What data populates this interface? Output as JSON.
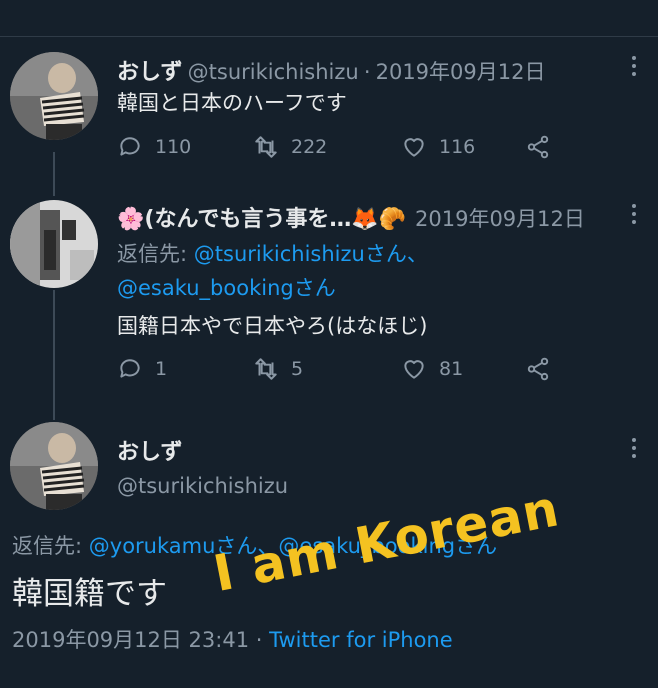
{
  "tweet1": {
    "name": "おしず",
    "handle": "@tsurikichishizu",
    "sep": "·",
    "date": "2019年09月12日",
    "text": "韓国と日本のハーフです",
    "replies": "110",
    "retweets": "222",
    "likes": "116"
  },
  "tweet2": {
    "name": "🌸(なんでも言う事を…🦊🥐",
    "date": "2019年09月12日",
    "reply_prefix": "返信先: ",
    "reply_to_1": "@tsurikichishizuさん、",
    "reply_to_2": "@esaku_bookingさん",
    "text": "国籍日本やで日本やろ(はなほじ)",
    "replies": "1",
    "retweets": "5",
    "likes": "81"
  },
  "tweet3": {
    "name": "おしず",
    "handle": "@tsurikichishizu",
    "reply_prefix": "返信先: ",
    "reply_to_1": "@yorukamuさん、",
    "reply_to_2": "@esaku_bookingさん",
    "text": "韓国籍です",
    "timestamp": "2019年09月12日 23:41",
    "sep": "·",
    "client": "Twitter for iPhone"
  },
  "overlay_text": "I am Korean",
  "colors": {
    "background": "#15202b",
    "link": "#1d9bf0",
    "overlay": "#f4c221",
    "muted": "#8b98a5"
  },
  "icons": [
    "reply-icon",
    "retweet-icon",
    "like-icon",
    "share-icon",
    "more-icon"
  ]
}
